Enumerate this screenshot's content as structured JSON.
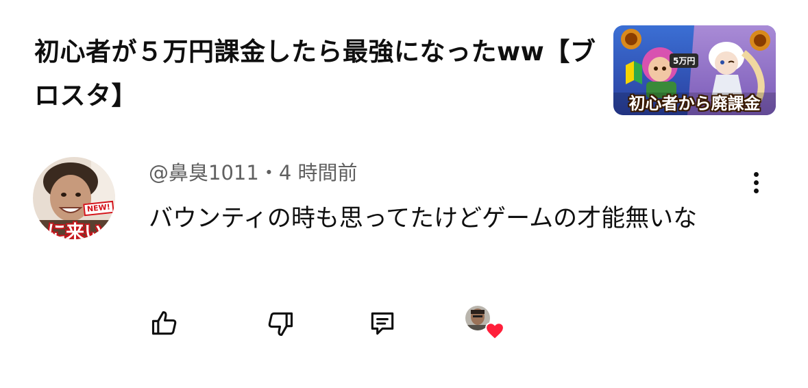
{
  "video": {
    "title": "初心者が５万円課金したら最強になったww【ブロスタ】",
    "thumbnail_caption": "初心者から廃課金",
    "thumbnail_price": "5万円"
  },
  "comment": {
    "avatar_badge": "NEW!",
    "avatar_text": "人に来い",
    "handle": "@鼻臭1011",
    "separator": "・",
    "time": "4 時間前",
    "text": "バウンティの時も思ってたけどゲームの才能無いな"
  },
  "actions": {
    "like_icon": "thumbs-up-icon",
    "dislike_icon": "thumbs-down-icon",
    "reply_icon": "comment-icon",
    "more_icon": "three-dots-vertical-icon",
    "heart_icon": "heart-icon",
    "heart_color": "#ff1f3a"
  }
}
